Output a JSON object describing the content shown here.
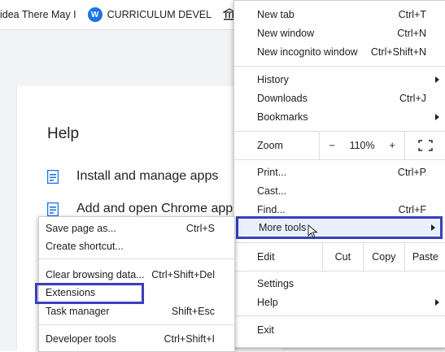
{
  "bookmarks": [
    {
      "label": "idea There May I",
      "icon": "none"
    },
    {
      "label": "CURRICULUM DEVEL",
      "icon": "wordpress-icon"
    },
    {
      "label": "",
      "icon": "bank-icon"
    }
  ],
  "help": {
    "title": "Help",
    "items": [
      "Install and manage apps",
      "Add and open Chrome apps"
    ]
  },
  "menu": {
    "new_tab": {
      "label": "New tab",
      "shortcut": "Ctrl+T"
    },
    "new_window": {
      "label": "New window",
      "shortcut": "Ctrl+N"
    },
    "new_incognito": {
      "label": "New incognito window",
      "shortcut": "Ctrl+Shift+N"
    },
    "history": {
      "label": "History"
    },
    "downloads": {
      "label": "Downloads",
      "shortcut": "Ctrl+J"
    },
    "bookmarks": {
      "label": "Bookmarks"
    },
    "zoom": {
      "label": "Zoom",
      "minus": "−",
      "value": "110%",
      "plus": "+"
    },
    "print": {
      "label": "Print...",
      "shortcut": "Ctrl+P"
    },
    "cast": {
      "label": "Cast..."
    },
    "find": {
      "label": "Find...",
      "shortcut": "Ctrl+F"
    },
    "more_tools": {
      "label": "More tools"
    },
    "edit": {
      "label": "Edit",
      "cut": "Cut",
      "copy": "Copy",
      "paste": "Paste"
    },
    "settings": {
      "label": "Settings"
    },
    "help": {
      "label": "Help"
    },
    "exit": {
      "label": "Exit"
    }
  },
  "submenu": {
    "save_page": {
      "label": "Save page as...",
      "shortcut": "Ctrl+S"
    },
    "create_shortcut": {
      "label": "Create shortcut..."
    },
    "clear_browsing": {
      "label": "Clear browsing data...",
      "shortcut": "Ctrl+Shift+Del"
    },
    "extensions": {
      "label": "Extensions"
    },
    "task_manager": {
      "label": "Task manager",
      "shortcut": "Shift+Esc"
    },
    "developer_tools": {
      "label": "Developer tools",
      "shortcut": "Ctrl+Shift+I"
    }
  },
  "colors": {
    "highlight_border": "#3a3fbd",
    "doc_icon": "#1a73e8"
  }
}
